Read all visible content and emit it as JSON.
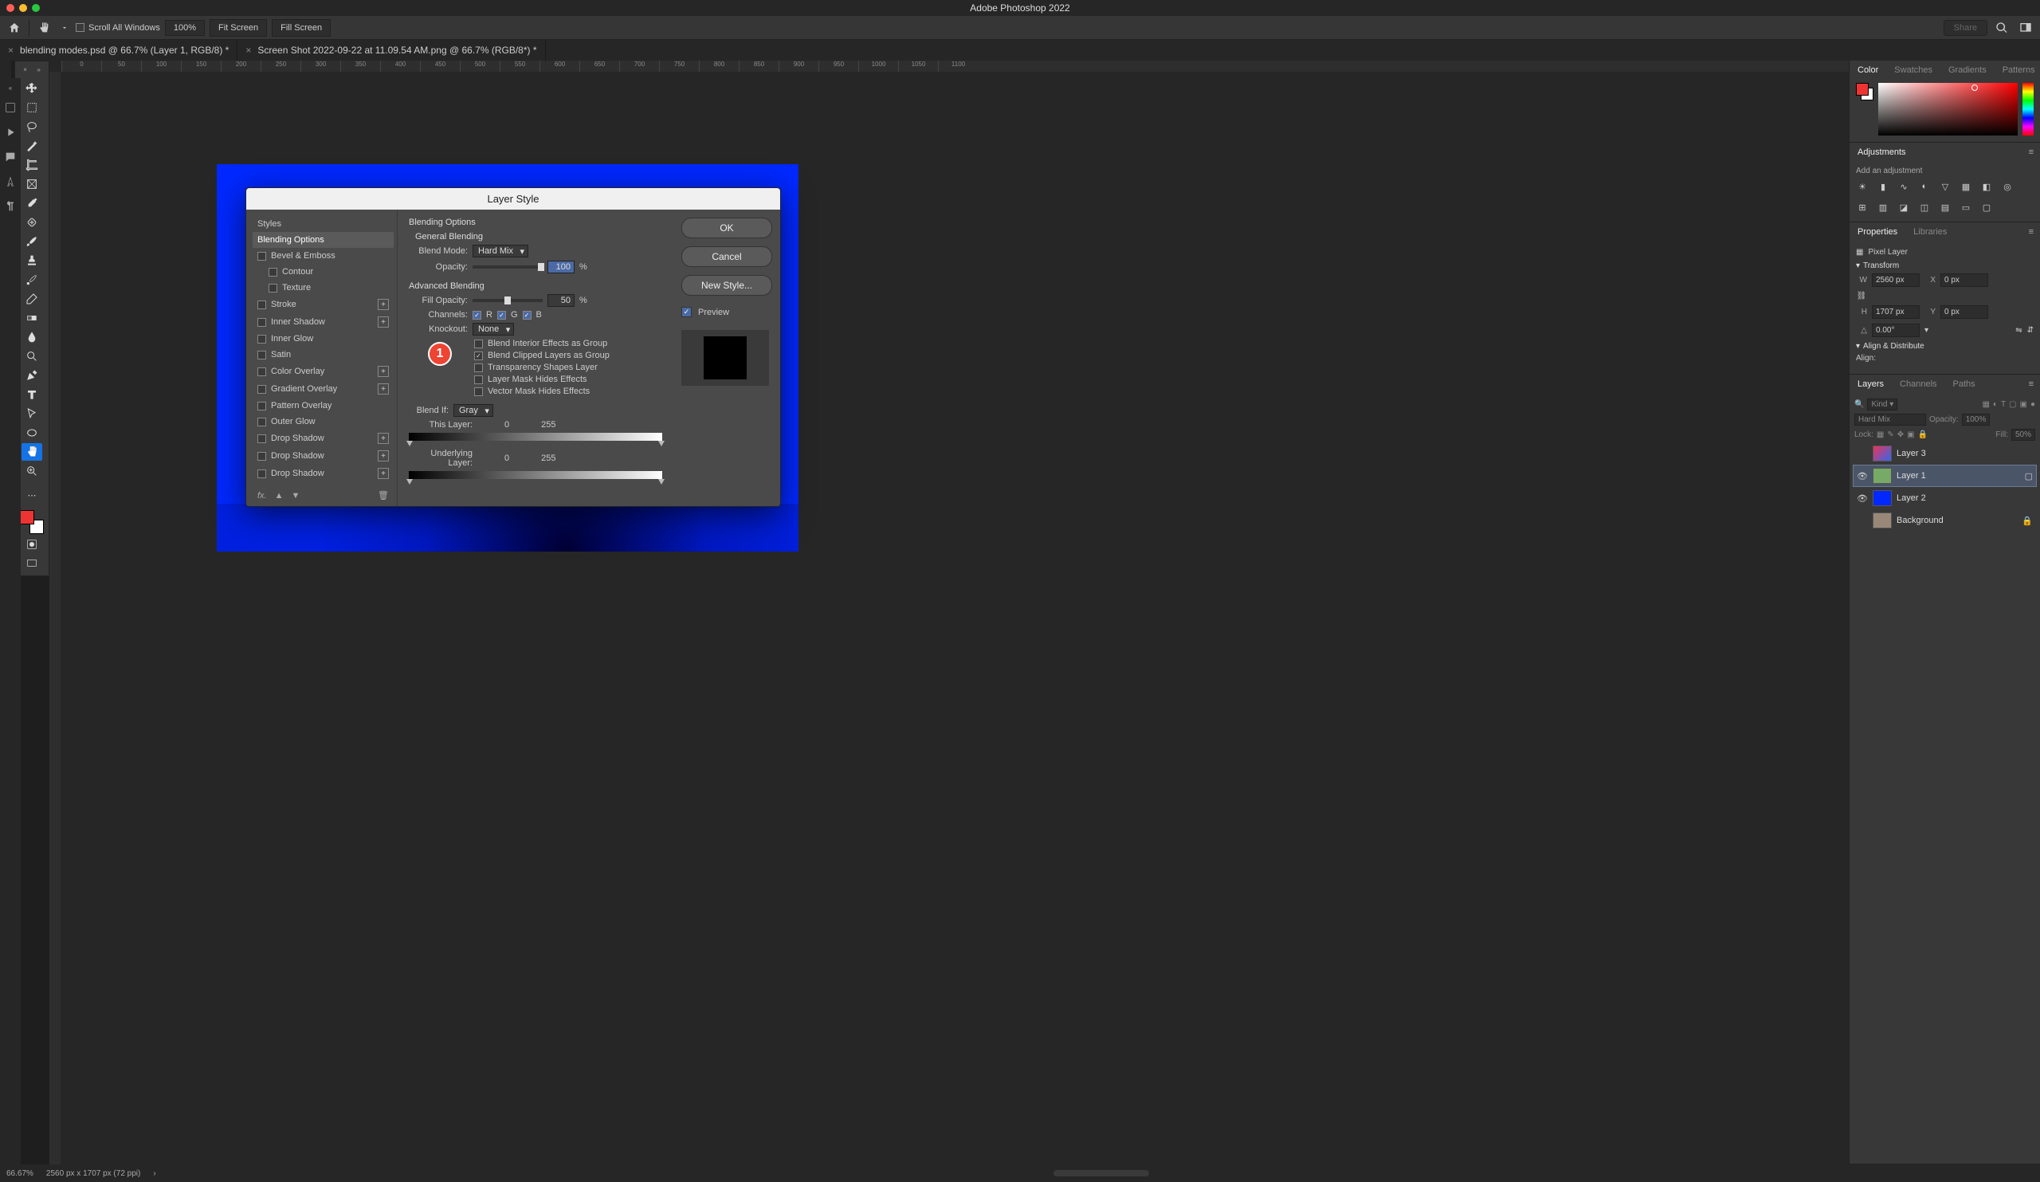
{
  "app_title": "Adobe Photoshop 2022",
  "options": {
    "scroll_all": "Scroll All Windows",
    "zoom": "100%",
    "fit": "Fit Screen",
    "fill": "Fill Screen",
    "share": "Share"
  },
  "tabs": [
    "blending modes.psd @ 66.7% (Layer 1, RGB/8) *",
    "Screen Shot 2022-09-22 at 11.09.54 AM.png @ 66.7% (RGB/8*) *"
  ],
  "ruler_marks": [
    "0",
    "50",
    "100",
    "150",
    "200",
    "250",
    "300",
    "350",
    "400",
    "450",
    "500",
    "550",
    "600",
    "650",
    "700",
    "750",
    "800",
    "850",
    "900",
    "950",
    "1000",
    "1050",
    "1100"
  ],
  "panels": {
    "color": "Color",
    "swatches": "Swatches",
    "gradients": "Gradients",
    "patterns": "Patterns",
    "adjustments": "Adjustments",
    "adj_hint": "Add an adjustment",
    "properties": "Properties",
    "libraries": "Libraries",
    "prop_kind": "Pixel Layer",
    "transform": "Transform",
    "W": "2560 px",
    "H": "1707 px",
    "X": "0 px",
    "Y": "0 px",
    "angle": "0.00°",
    "align": "Align & Distribute",
    "align_lab": "Align:",
    "layers": "Layers",
    "channels": "Channels",
    "paths": "Paths",
    "kind": "Kind",
    "blend": "Hard Mix",
    "opacity_lab": "Opacity:",
    "opacity_val": "100%",
    "lock": "Lock:",
    "fill_lab": "Fill:",
    "fill_val": "50%",
    "layer_list": [
      "Layer 3",
      "Layer 1",
      "Layer 2",
      "Background"
    ]
  },
  "status": {
    "zoom": "66.67%",
    "doc": "2560 px x 1707 px (72 ppi)"
  },
  "dialog": {
    "title": "Layer Style",
    "styles_head": "Styles",
    "items": {
      "blending": "Blending Options",
      "bevel": "Bevel & Emboss",
      "contour": "Contour",
      "texture": "Texture",
      "stroke": "Stroke",
      "inner_shadow": "Inner Shadow",
      "inner_glow": "Inner Glow",
      "satin": "Satin",
      "color_overlay": "Color Overlay",
      "gradient_overlay": "Gradient Overlay",
      "pattern_overlay": "Pattern Overlay",
      "outer_glow": "Outer Glow",
      "drop_shadow": "Drop Shadow"
    },
    "section": {
      "blend_opts": "Blending Options",
      "general": "General Blending",
      "mode": "Blend Mode:",
      "mode_val": "Hard Mix",
      "opacity": "Opacity:",
      "opacity_val": "100",
      "pct": "%",
      "advanced": "Advanced Blending",
      "fill_opacity": "Fill Opacity:",
      "fill_val": "50",
      "channels": "Channels:",
      "r": "R",
      "g": "G",
      "b": "B",
      "knockout": "Knockout:",
      "knockout_val": "None",
      "chk1": "Blend Interior Effects as Group",
      "chk2": "Blend Clipped Layers as Group",
      "chk3": "Transparency Shapes Layer",
      "chk4": "Layer Mask Hides Effects",
      "chk5": "Vector Mask Hides Effects",
      "blendif": "Blend If:",
      "blendif_val": "Gray",
      "this_layer": "This Layer:",
      "tl0": "0",
      "tl1": "255",
      "under": "Underlying Layer:",
      "ul0": "0",
      "ul1": "255"
    },
    "buttons": {
      "ok": "OK",
      "cancel": "Cancel",
      "new_style": "New Style...",
      "preview": "Preview"
    },
    "annotation": "1"
  }
}
